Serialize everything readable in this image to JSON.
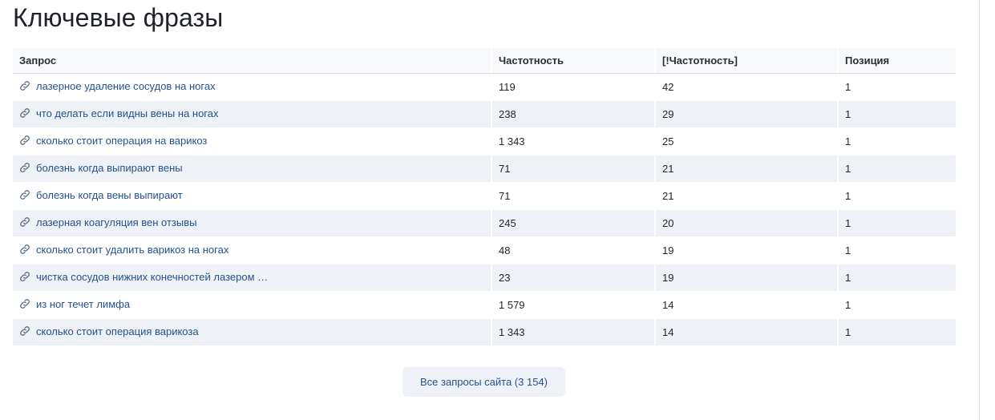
{
  "page": {
    "title": "Ключевые фразы"
  },
  "table": {
    "headers": {
      "query": "Запрос",
      "frequency": "Частотность",
      "exact_frequency": "[!Частотность]",
      "position": "Позиция"
    },
    "rows": [
      {
        "query": "лазерное удаление сосудов на ногах",
        "frequency": "119",
        "exact_frequency": "42",
        "position": "1"
      },
      {
        "query": "что делать если видны вены на ногах",
        "frequency": "238",
        "exact_frequency": "29",
        "position": "1"
      },
      {
        "query": "сколько стоит операция на варикоз",
        "frequency": "1 343",
        "exact_frequency": "25",
        "position": "1"
      },
      {
        "query": "болезнь когда выпирают вены",
        "frequency": "71",
        "exact_frequency": "21",
        "position": "1"
      },
      {
        "query": "болезнь когда вены выпирают",
        "frequency": "71",
        "exact_frequency": "21",
        "position": "1"
      },
      {
        "query": "лазерная коагуляция вен отзывы",
        "frequency": "245",
        "exact_frequency": "20",
        "position": "1"
      },
      {
        "query": "сколько стоит удалить варикоз на ногах",
        "frequency": "48",
        "exact_frequency": "19",
        "position": "1"
      },
      {
        "query": "чистка сосудов нижних конечностей лазером …",
        "frequency": "23",
        "exact_frequency": "19",
        "position": "1"
      },
      {
        "query": "из ног течет лимфа",
        "frequency": "1 579",
        "exact_frequency": "14",
        "position": "1"
      },
      {
        "query": "сколько стоит операция варикоза",
        "frequency": "1 343",
        "exact_frequency": "14",
        "position": "1"
      }
    ],
    "row_icon": "link-icon"
  },
  "footer": {
    "all_queries_label": "Все запросы сайта (3 154)"
  },
  "colors": {
    "link": "#24528f",
    "stripe": "#eef1f6",
    "header_bg": "#f7f8fa"
  }
}
